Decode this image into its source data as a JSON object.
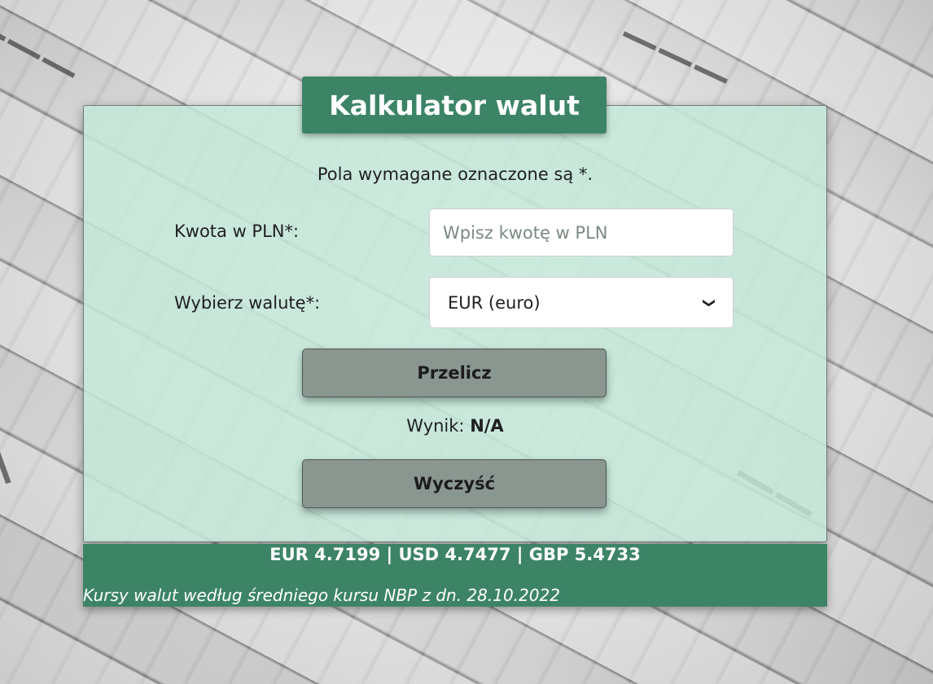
{
  "app": {
    "title": "Kalkulator walut"
  },
  "form": {
    "required_note": "Pola wymagane oznaczone są *.",
    "amount_label": "Kwota w PLN*:",
    "amount_placeholder": "Wpisz kwotę w PLN",
    "amount_value": "",
    "currency_label": "Wybierz walutę*:",
    "currency_selected": "EUR (euro)",
    "convert_button": "Przelicz",
    "result_label": "Wynik:",
    "result_value": "N/A",
    "clear_button": "Wyczyść"
  },
  "footer": {
    "rates": "EUR 4.7199 | USD 4.7477 | GBP 5.4733",
    "source_note": "Kursy walut według średniego kursu NBP z dn. 28.10.2022"
  },
  "colors": {
    "accent_green": "#3d8467",
    "card_background": "#c4e8d9",
    "button_gray": "#8a9690"
  },
  "icons": {
    "select_chevron": "chevron-down-icon"
  }
}
